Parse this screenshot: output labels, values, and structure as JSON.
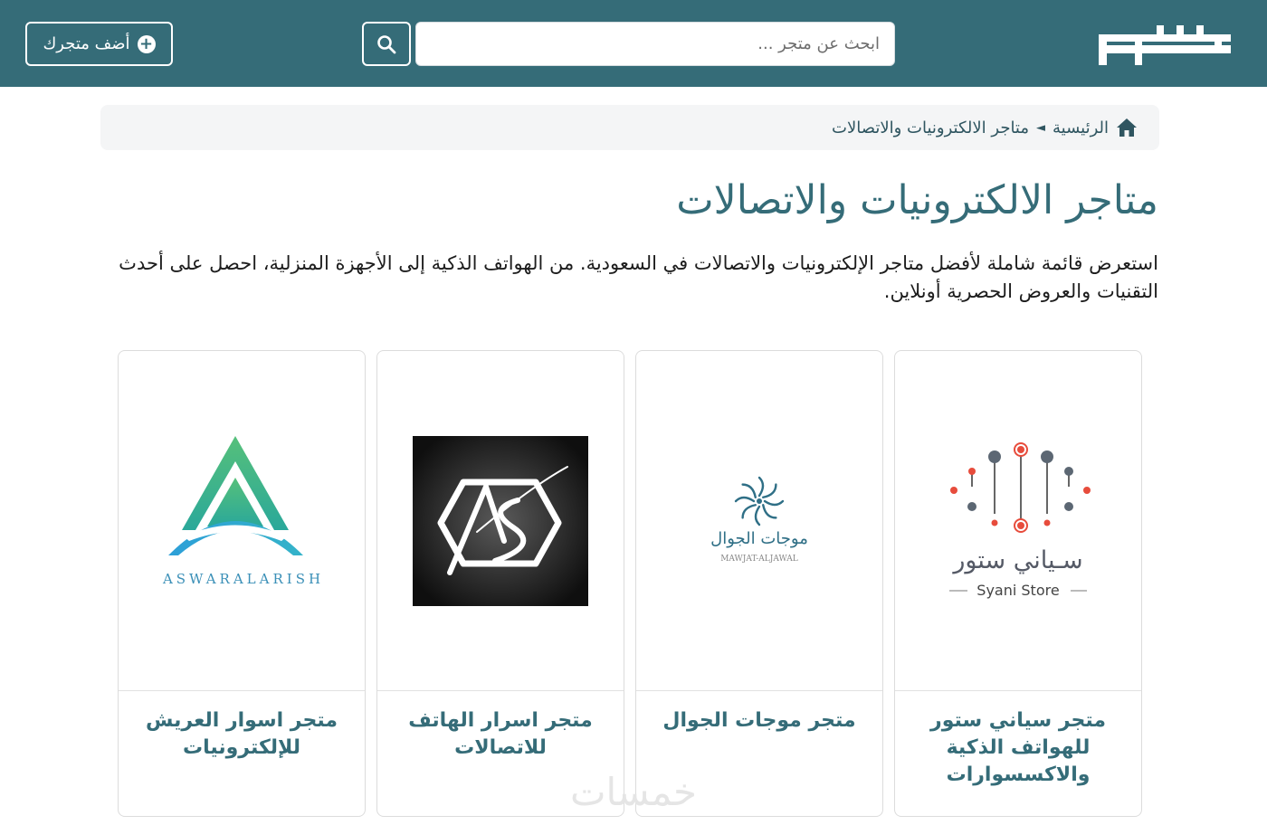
{
  "header": {
    "search_placeholder": "ابحث عن متجر ...",
    "add_store_label": "أضف متجرك",
    "brand_color": "#356c78"
  },
  "breadcrumb": {
    "home": "الرئيسية",
    "separator": "◄",
    "current": "متاجر الالكترونيات والاتصالات"
  },
  "main": {
    "title": "متاجر الالكترونيات والاتصالات",
    "description": "استعرض قائمة شاملة لأفضل متاجر الإلكترونيات والاتصالات في السعودية. من الهواتف الذكية إلى الأجهزة المنزلية، احصل على أحدث التقنيات والعروض الحصرية أونلاين."
  },
  "stores": [
    {
      "name": "متجر سياني ستور للهواتف الذكية والاكسسوارات",
      "logo_text_ar": "سـياني ستور",
      "logo_text_en": "Syani Store"
    },
    {
      "name": "متجر موجات الجوال",
      "logo_text_ar": "موجات الجوال",
      "logo_text_en": "MAWJAT-ALJAWAL"
    },
    {
      "name": "متجر اسرار الهاتف للاتصالات",
      "logo_text_en": "AS"
    },
    {
      "name": "متجر اسوار العريش للإلكترونيات",
      "logo_text_en": "ASWARALARISH"
    }
  ],
  "watermark": "خمسات",
  "icons": {
    "logo": "site-logo",
    "search": "search-icon",
    "add": "plus-circle-icon",
    "home": "home-icon"
  }
}
